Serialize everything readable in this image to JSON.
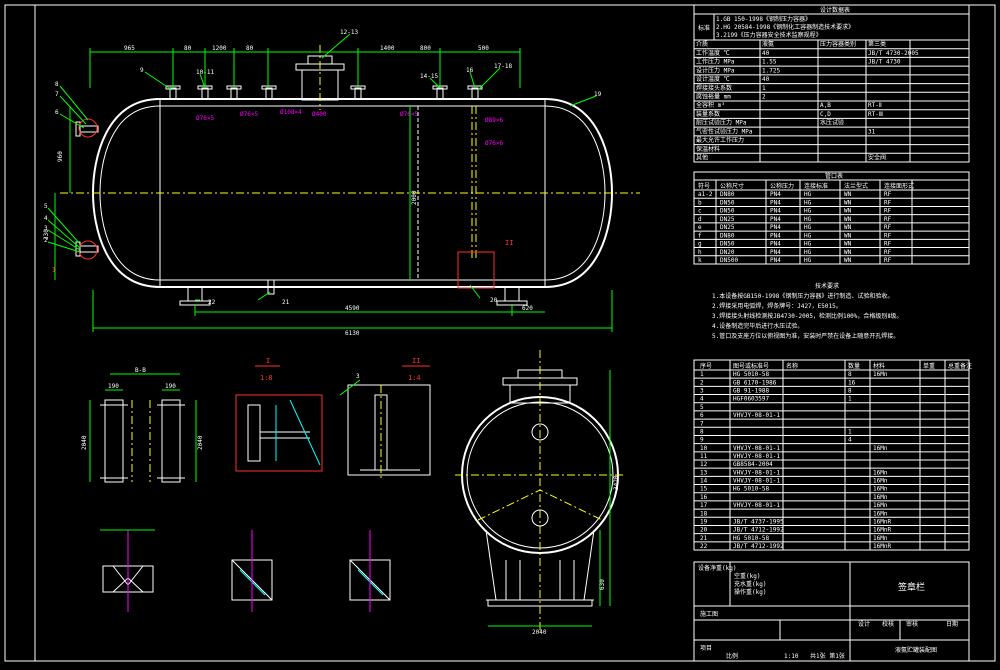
{
  "spec_table": {
    "title": "设计数据表",
    "std_head": "标准",
    "standards": [
      "1.GB 150-1998《钢制压力容器》",
      "2.HG 20584-1998《钢制化工容器制造技术要求》",
      "3.2199《压力容器安全技术监察规程》"
    ],
    "rows": [
      [
        "介质",
        "液氨",
        "压力容器类别",
        "第三类"
      ],
      [
        "工作温度 ℃",
        "40",
        "",
        "JB/T 4730-2005"
      ],
      [
        "工作压力 MPa",
        "1.55",
        "",
        "JB/T 4730"
      ],
      [
        "设计压力 MPa",
        "1.725",
        "",
        ""
      ],
      [
        "设计温度 ℃",
        "40",
        "",
        ""
      ],
      [
        "焊接接头系数",
        "1",
        "",
        ""
      ],
      [
        "腐蚀裕量 mm",
        "2",
        "",
        ""
      ],
      [
        "全容积 m³",
        "",
        "A,B",
        "RT-Ⅱ"
      ],
      [
        "装量系数",
        "",
        "C,D",
        "RT-Ⅲ"
      ],
      [
        "耐压试验压力 MPa",
        "",
        "水压试验",
        ""
      ],
      [
        "气密性试验压力 MPa",
        "",
        "",
        "31"
      ],
      [
        "最大允许工作压力",
        "",
        "",
        ""
      ],
      [
        "保温材料",
        "",
        "",
        ""
      ],
      [
        "其他",
        "",
        "",
        "安全阀"
      ]
    ]
  },
  "nozzle_table": {
    "title": "管口表",
    "headers": [
      "符号",
      "公称尺寸",
      "公称压力",
      "连接标准",
      "法兰型式",
      "连接面形式"
    ],
    "rows": [
      [
        "a1-2",
        "DN80",
        "PN4",
        "HG",
        "WN",
        "RF"
      ],
      [
        "b",
        "DN50",
        "PN4",
        "HG",
        "WN",
        "RF"
      ],
      [
        "c",
        "DN50",
        "PN4",
        "HG",
        "WN",
        "RF"
      ],
      [
        "d",
        "DN25",
        "PN4",
        "HG",
        "WN",
        "RF"
      ],
      [
        "e",
        "DN25",
        "PN4",
        "HG",
        "WN",
        "RF"
      ],
      [
        "f",
        "DN80",
        "PN4",
        "HG",
        "WN",
        "RF"
      ],
      [
        "g",
        "DN50",
        "PN4",
        "HG",
        "WN",
        "RF"
      ],
      [
        "h",
        "DN20",
        "PN4",
        "HG",
        "WN",
        "RF"
      ],
      [
        "k",
        "DN500",
        "PN4",
        "HG",
        "WN",
        "RF"
      ]
    ]
  },
  "notes": {
    "title": "技术要求",
    "lines": [
      "1.本设备按GB150-1998《钢制压力容器》进行制造、试验和验收。",
      "2.焊接采用电弧焊，焊条牌号：J427，E5015。",
      "3.焊接接头射线检测按JB4730-2005，检测比例100%，合格级别Ⅱ级。",
      "4.设备制造完毕后进行水压试验。",
      "5.管口及支座方位以俯视图为准，安装时严禁在设备上随意开孔焊接。"
    ]
  },
  "parts_table": {
    "headers": [
      "序号",
      "图号或标准号",
      "名称",
      "数量",
      "材料",
      "单重",
      "总重",
      "备注"
    ],
    "rows": [
      [
        "1",
        "HG 5010-58",
        "",
        "8",
        "16Mn"
      ],
      [
        "2",
        "GB 6170-1986",
        "",
        "16",
        ""
      ],
      [
        "3",
        "GB 91-1988",
        "",
        "8",
        ""
      ],
      [
        "4",
        "HGF0603597",
        "",
        "1",
        ""
      ],
      [
        "5",
        "",
        "",
        "",
        ""
      ],
      [
        "6",
        "VHVJY-08-01-1",
        "",
        "",
        ""
      ],
      [
        "7",
        "",
        "",
        "",
        ""
      ],
      [
        "8",
        "",
        "",
        "1",
        ""
      ],
      [
        "9",
        "",
        "",
        "4",
        ""
      ],
      [
        "10",
        "VHVJY-08-01-1",
        "",
        "",
        "16Mn"
      ],
      [
        "11",
        "VHVJY-08-01-1",
        "",
        "",
        ""
      ],
      [
        "12",
        "GB8584-2004",
        "",
        "",
        ""
      ],
      [
        "13",
        "VHVJY-08-01-1",
        "",
        "",
        "16Mn"
      ],
      [
        "14",
        "VHVJY-08-01-1",
        "",
        "",
        "16Mn"
      ],
      [
        "15",
        "HG 5010-58",
        "",
        "",
        "16Mn"
      ],
      [
        "16",
        "",
        "",
        "",
        "16Mn"
      ],
      [
        "17",
        "VHVJY-08-01-1",
        "",
        "",
        "16Mn"
      ],
      [
        "18",
        "",
        "",
        "",
        "16Mn"
      ],
      [
        "19",
        "JB/T 4737-1995",
        "",
        "",
        "16MnR"
      ],
      [
        "20",
        "JB/T 4712-1992",
        "",
        "",
        "16MnR"
      ],
      [
        "21",
        "HG 5010-58",
        "",
        "",
        "16Mn"
      ],
      [
        "22",
        "JB/T 4712-1992",
        "",
        "",
        "16MnR"
      ]
    ]
  },
  "title_block": {
    "stamp": "签章栏",
    "weight_label": "设备净重(kg)",
    "weights": [
      "空重(kg)",
      "充水重(kg)",
      "操作重(kg)"
    ],
    "role_design": "设计",
    "role_check": "校核",
    "role_review": "审核",
    "role_approve": "日期",
    "phase": "施工图",
    "drawing_title": "液氨贮罐装配图",
    "scale_label": "比例",
    "scale": "1:10",
    "sheet": "共1张 第1张",
    "project": "项目"
  },
  "main_view": {
    "dims_top": [
      "965",
      "80",
      "1200",
      "80",
      "1400",
      "800",
      "500"
    ],
    "dim_total_top": "",
    "dims_bottom": [
      "4590",
      "620"
    ],
    "dim_total": "6130",
    "dim_height": "2030",
    "dim_left": "960",
    "dim_nozzle": "Ø400",
    "dim_pipe": [
      "Ø76×5",
      "Ø76×5",
      "Ø108×4",
      "Ø76×5",
      "Ø89×6",
      "Ø76×6"
    ],
    "dim_side": "330",
    "dim_inner": "2000",
    "callouts": [
      "8",
      "7",
      "6",
      "5",
      "4",
      "3",
      "2",
      "9",
      "10-11",
      "12-13",
      "14-15",
      "16",
      "17-18",
      "19",
      "20",
      "21",
      "22"
    ],
    "section_mark_I": "I",
    "section_mark_II": "II"
  },
  "details": {
    "view_bb": "B-B",
    "dims_bb": [
      "190",
      "190",
      "2040",
      "2040"
    ],
    "view_I": "I",
    "scale_I": "1:8",
    "view_II": "II",
    "scale_II": "1:4",
    "dim_II": "3",
    "end_view": {
      "height": "3420",
      "width": "2040",
      "dim_leg": "630"
    }
  }
}
